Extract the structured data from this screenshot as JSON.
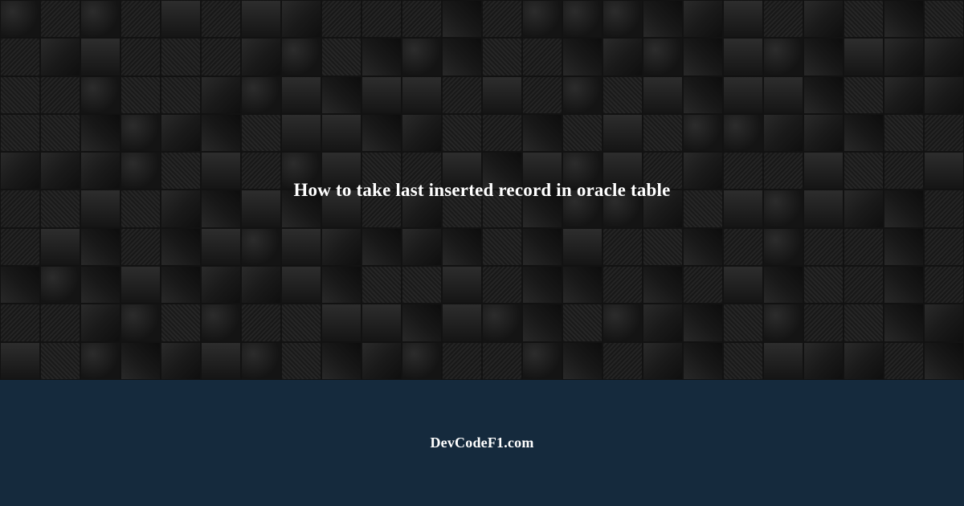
{
  "hero": {
    "title": "How to take last inserted record in oracle table"
  },
  "footer": {
    "site_name": "DevCodeF1.com"
  },
  "colors": {
    "footer_bg": "#152a3d",
    "text": "#ffffff",
    "tile_dark": "#1a1a1a"
  }
}
